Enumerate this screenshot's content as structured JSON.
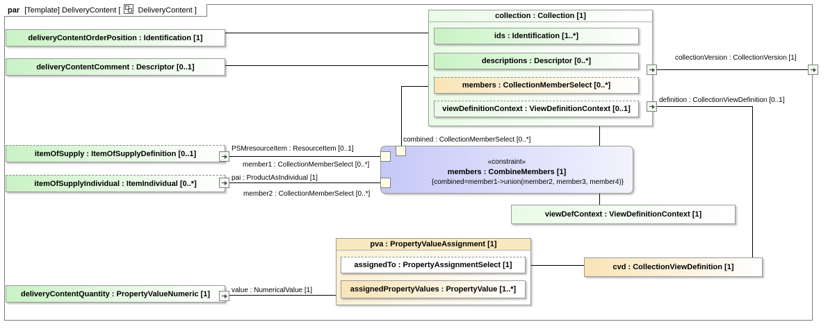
{
  "frame": {
    "kind": "par",
    "template": "[Template]",
    "name": "DeliveryContent",
    "bracket_open": "[",
    "icon": "block-icon",
    "ref": "DeliveryContent",
    "bracket_close": "]"
  },
  "parts": {
    "order_position": "deliveryContentOrderPosition : Identification [1]",
    "comment": "deliveryContentComment : Descriptor [0..1]",
    "item_of_supply": "itemOfSupply : ItemOfSupplyDefinition [0..1]",
    "item_of_supply_individual": "itemOfSupplyIndividual : ItemIndividual [0..*]",
    "quantity": "deliveryContentQuantity : PropertyValueNumeric [1]",
    "view_def_context": "viewDefContext : ViewDefinitionContext [1]",
    "cvd": "cvd : CollectionViewDefinition [1]"
  },
  "collection": {
    "title": "collection : Collection [1]",
    "ids": "ids : Identification [1..*]",
    "descriptions": "descriptions : Descriptor [0..*]",
    "members": "members : CollectionMemberSelect [0..*]",
    "view_definition_context": "viewDefinitionContext : ViewDefinitionContext [0..1]"
  },
  "pva": {
    "title": "pva : PropertyValueAssignment [1]",
    "assigned_to": "assignedTo : PropertyAssignmentSelect [1]",
    "assigned_values": "assignedPropertyValues : PropertyValue [1..*]"
  },
  "constraint": {
    "stereotype": "«constraint»",
    "name": "members : CombineMembers [1]",
    "expression": "{combined=member1->union(member2, member3, member4)}"
  },
  "labels": {
    "collection_version": "collectionVersion : CollectionVersion [1]",
    "definition": "definition : CollectionViewDefinition [0..1]",
    "combined": "combined : CollectionMemberSelect [0..*]",
    "psm_resource_item": "PSMresourceItem : ResourceItem [0..1]",
    "member1": "member1 : CollectionMemberSelect [0..*]",
    "pai": "pai : ProductAsIndividual [1]",
    "member2": "member2 : CollectionMemberSelect [0..*]",
    "value": "value : NumericalValue [1]"
  },
  "colors": {
    "part_green": "#c9f2c4",
    "part_yellow": "#f9e4b6",
    "constraint_blue": "#c5c8f7",
    "line": "#000000"
  }
}
